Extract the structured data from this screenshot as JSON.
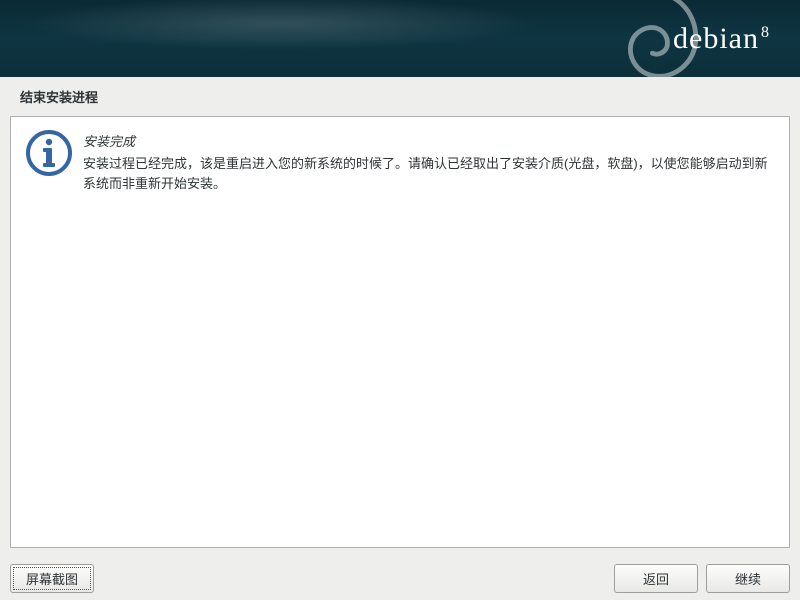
{
  "header": {
    "brand": "debian",
    "version": "8"
  },
  "title": "结束安装进程",
  "message": {
    "heading": "安装完成",
    "body": "安装过程已经完成，该是重启进入您的新系统的时候了。请确认已经取出了安装介质(光盘，软盘)，以使您能够启动到新系统而非重新开始安装。"
  },
  "buttons": {
    "screenshot": "屏幕截图",
    "back": "返回",
    "continue": "继续"
  },
  "colors": {
    "header_bg": "#0f3542",
    "panel_bg": "#ffffff",
    "page_bg": "#eeeeec",
    "info_icon": "#3465a4"
  }
}
